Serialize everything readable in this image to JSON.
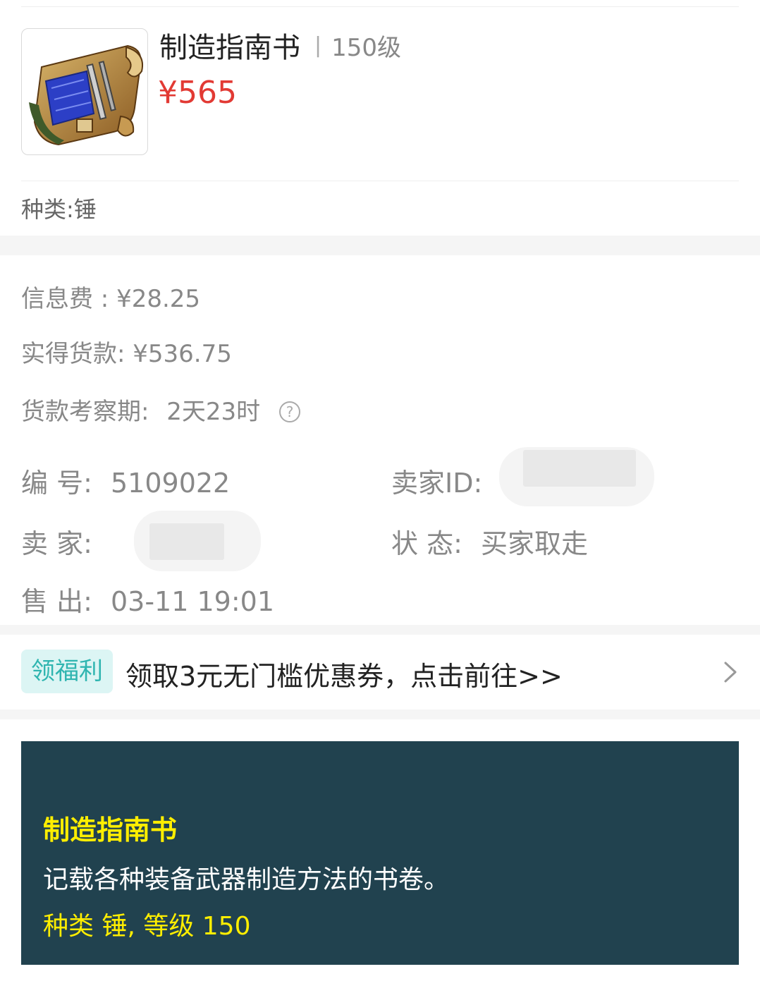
{
  "item": {
    "title": "制造指南书",
    "separator": "|",
    "level": "150级",
    "price": "¥565",
    "category": "种类:锤",
    "image": "scroll-blueprint-icon"
  },
  "fees": {
    "info_fee": "信息费 : ¥28.25",
    "net_proceeds": "实得货款:  ¥536.75",
    "review_period_label": "货款考察期:",
    "review_period_value": "2天23时",
    "help_glyph": "?"
  },
  "details": {
    "id_label": "编  号:",
    "id_value": "5109022",
    "seller_id_label": "卖家ID:",
    "seller_label": "卖  家:",
    "status_label": "状  态:",
    "status_value": "买家取走",
    "sold_label": "售  出:",
    "sold_value": "03-11 19:01"
  },
  "promo": {
    "badge": "领福利",
    "text": "领取3元无门槛优惠券，点击前往>>"
  },
  "tooltip": {
    "name": "制造指南书",
    "description": "记载各种装备武器制造方法的书卷。",
    "meta": "种类 锤, 等级 150"
  },
  "colors": {
    "price": "#e23a34",
    "badge_bg": "#dcf5f4",
    "badge_text": "#2fb5b0",
    "tooltip_bg": "#21424f",
    "tooltip_highlight": "#ffee00"
  }
}
